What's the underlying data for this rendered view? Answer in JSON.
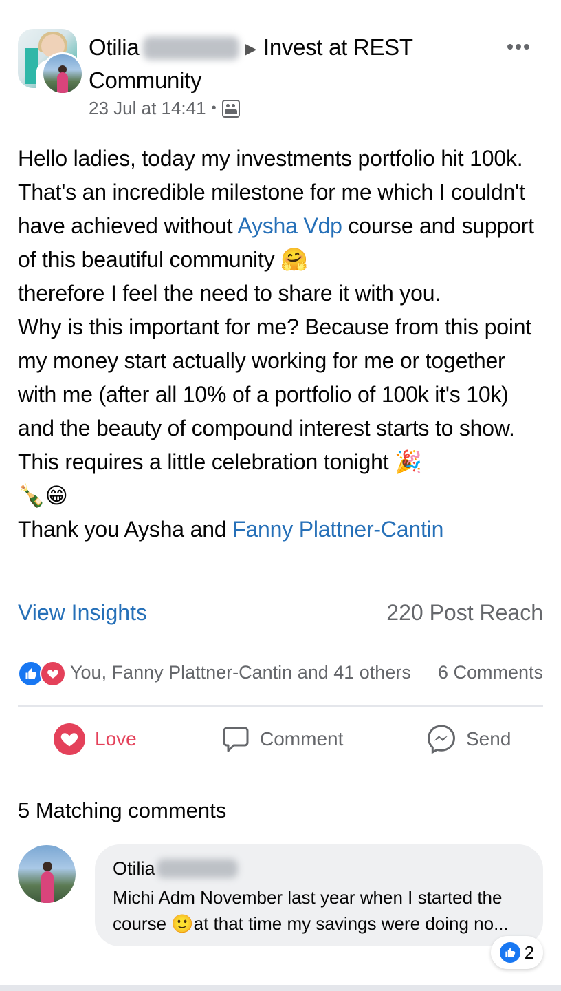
{
  "post": {
    "author_first_name": "Otilia",
    "arrow": "▶",
    "group_name": "Invest at REST Community",
    "timestamp": "23 Jul at 14:41",
    "separator": "•",
    "more_label": "•••",
    "body": {
      "line1": "Hello ladies, today my investments portfolio hit 100k.",
      "line2_a": " That's an incredible milestone for me which I couldn't have achieved without ",
      "mention1": "Aysha Vdp",
      "line2_b": " course and support of this beautiful community ",
      "emoji_hug": "🤗",
      "line3": " therefore I feel the need to share it with you.",
      "line4": " Why is this important for me? Because from this point my money start actually working for me or together with me (after all 10% of a portfolio of 100k it's 10k) and the beauty of compound interest starts to show. This requires a little celebration tonight ",
      "emoji_party": "🎉",
      "emoji_bottle": "🍾",
      "emoji_grin": "😁",
      "thanks": "Thank you Aysha and ",
      "mention2": "Fanny Plattner-Cantin"
    },
    "view_insights": "View Insights",
    "post_reach": "220 Post Reach",
    "reactions_text": "You, Fanny Plattner-Cantin and 41 others",
    "comments_count": "6 Comments",
    "like_glyph": "👍",
    "heart_glyph": "❤"
  },
  "actions": {
    "love": "Love",
    "comment": "Comment",
    "send": "Send"
  },
  "comments": {
    "header": "5 Matching comments",
    "items": [
      {
        "author": "Otilia",
        "text": "Michi Adm November last year when I started the course 🙂at that time my savings were doing no...",
        "like_count": "2"
      }
    ]
  },
  "colors": {
    "link": "#2670b8",
    "love": "#e4415a",
    "like": "#1877f2",
    "muted": "#65676b"
  }
}
